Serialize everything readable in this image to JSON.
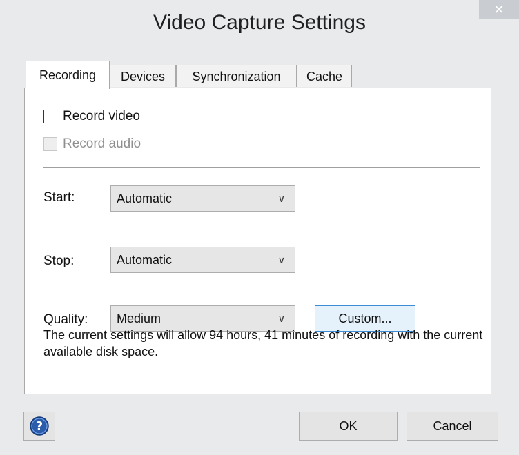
{
  "window": {
    "title": "Video Capture Settings",
    "close_glyph": "✕"
  },
  "tabs": [
    {
      "label": "Recording",
      "active": true
    },
    {
      "label": "Devices",
      "active": false
    },
    {
      "label": "Synchronization",
      "active": false
    },
    {
      "label": "Cache",
      "active": false
    }
  ],
  "recording": {
    "record_video": {
      "label": "Record video",
      "checked": false,
      "enabled": true
    },
    "record_audio": {
      "label": "Record audio",
      "checked": false,
      "enabled": false
    },
    "start": {
      "label": "Start:",
      "value": "Automatic"
    },
    "stop": {
      "label": "Stop:",
      "value": "Automatic"
    },
    "quality": {
      "label": "Quality:",
      "value": "Medium"
    },
    "custom_button": "Custom...",
    "info_text": "The current settings will allow 94 hours, 41 minutes of recording with the current available disk space."
  },
  "footer": {
    "help_icon": "help-icon",
    "ok_label": "OK",
    "cancel_label": "Cancel"
  },
  "colors": {
    "accent": "#3c8cd6",
    "help_blue": "#2a5cab"
  }
}
